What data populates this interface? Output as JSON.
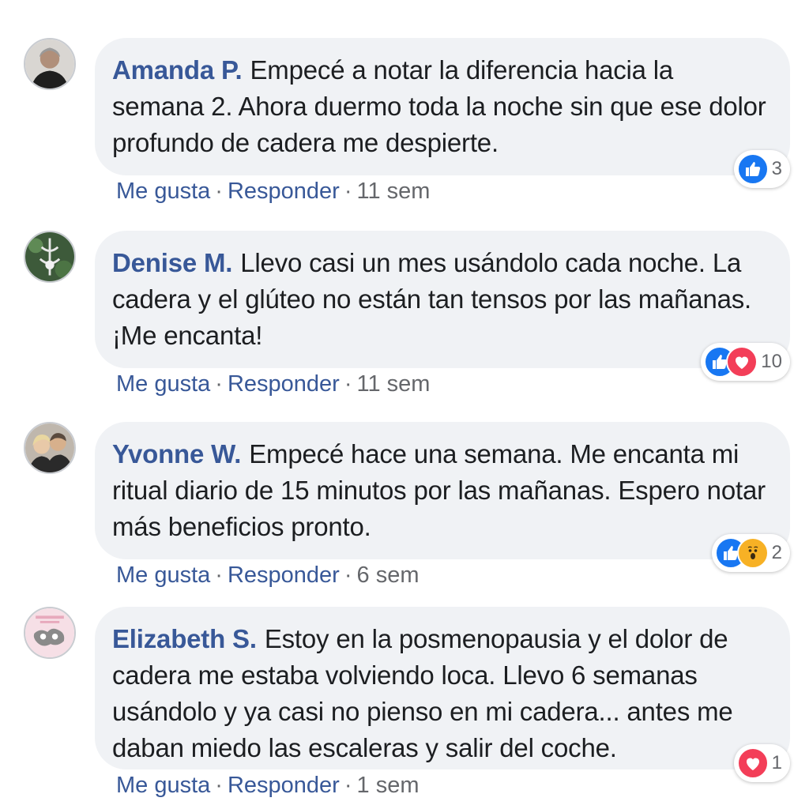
{
  "comments": [
    {
      "author": "Amanda P.",
      "text": "Empecé a notar la diferencia hacia la semana 2. Ahora duermo toda la noche sin que ese dolor profundo de cadera me despierte.",
      "reactions": [
        "like"
      ],
      "reaction_count": "3",
      "like_label": "Me gusta",
      "reply_label": "Responder",
      "time": "11 sem"
    },
    {
      "author": "Denise M.",
      "text": "Llevo casi un mes usándolo cada noche. La cadera y el glúteo no están tan tensos por las mañanas. ¡Me encanta!",
      "reactions": [
        "like",
        "love"
      ],
      "reaction_count": "10",
      "like_label": "Me gusta",
      "reply_label": "Responder",
      "time": "11 sem"
    },
    {
      "author": "Yvonne W.",
      "text": "Empecé hace una semana. Me encanta mi ritual diario de 15 minutos por las mañanas. Espero notar más beneficios pronto.",
      "reactions": [
        "like",
        "wow"
      ],
      "reaction_count": "2",
      "like_label": "Me gusta",
      "reply_label": "Responder",
      "time": "6 sem"
    },
    {
      "author": "Elizabeth S.",
      "text": "Estoy en la posmenopausia y el dolor de cadera me estaba volviendo loca. Llevo 6 semanas usándolo y ya casi no pienso en mi cadera... antes me daban miedo las escaleras y salir del coche.",
      "reactions": [
        "love"
      ],
      "reaction_count": "1",
      "like_label": "Me gusta",
      "reply_label": "Responder",
      "time": "1 sem"
    }
  ],
  "colors": {
    "author": "#385898",
    "bubble": "#f0f2f5",
    "like": "#1877f2",
    "love": "#f33e58",
    "wow": "#f7b125",
    "meta": "#65676b"
  }
}
